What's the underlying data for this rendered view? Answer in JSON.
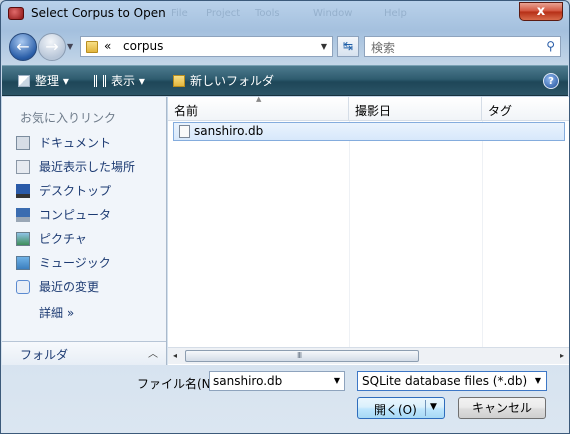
{
  "window": {
    "title": "Select Corpus to Open",
    "close_glyph": "x",
    "ghost_menus": [
      "File",
      "Project",
      "Tools",
      "Window",
      "Help"
    ]
  },
  "address": {
    "back_glyph": "←",
    "fwd_glyph": "→",
    "separator": "«",
    "path": "corpus",
    "refresh_glyph": "↹"
  },
  "search": {
    "placeholder": "検索",
    "icon_glyph": "⚲"
  },
  "toolbar": {
    "organize": "整理 ▾",
    "view": "表示 ▾",
    "new_folder": "新しいフォルダ",
    "help": "?"
  },
  "sidebar": {
    "favorites_heading": "お気に入りリンク",
    "items": [
      {
        "label": "ドキュメント",
        "icon": "documents-icon",
        "color": "#7b8c9e"
      },
      {
        "label": "最近表示した場所",
        "icon": "recent-places-icon",
        "color": "#8a97a6"
      },
      {
        "label": "デスクトップ",
        "icon": "desktop-icon",
        "color": "#2a5aa8"
      },
      {
        "label": "コンピュータ",
        "icon": "computer-icon",
        "color": "#3b6cb0"
      },
      {
        "label": "ピクチャ",
        "icon": "pictures-icon",
        "color": "#3f8f5a"
      },
      {
        "label": "ミュージック",
        "icon": "music-icon",
        "color": "#3c7fbf"
      },
      {
        "label": "最近の変更",
        "icon": "recent-changes-icon",
        "color": "#5b8ad0"
      }
    ],
    "more_label": "詳細  »",
    "folders_label": "フォルダ",
    "folders_chevron": "︿"
  },
  "filelist": {
    "columns": [
      "名前",
      "撮影日",
      "タグ"
    ],
    "files": [
      {
        "name": "sanshiro.db"
      }
    ],
    "scroll_left": "◂",
    "scroll_right": "▸",
    "scroll_grip": "III"
  },
  "bottom": {
    "filename_label": "ファイル名(N):",
    "filename_value": "sanshiro.db",
    "filter_value": "SQLite database files (*.db)",
    "open_label": "開く(O)",
    "cancel_label": "キャンセル"
  }
}
